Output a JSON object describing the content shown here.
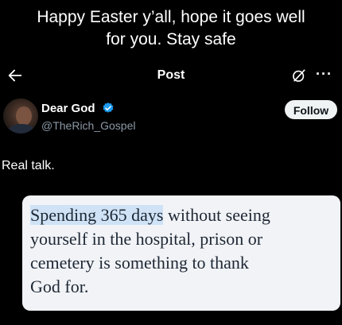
{
  "caption": {
    "line1": "Happy Easter y’all, hope it goes well",
    "line2": "for you. Stay safe"
  },
  "topbar": {
    "title": "Post",
    "more": "···"
  },
  "author": {
    "name": "Dear God",
    "handle": "@TheRich_Gospel",
    "follow_label": "Follow",
    "verified_color": "#1d9bf0"
  },
  "tweet": {
    "text": "Real talk."
  },
  "quote_image": {
    "highlighted": "Spending 365 days",
    "rest_line1": " without seeing",
    "line2": "yourself in the hospital, prison or",
    "line3": "cemetery is something to thank",
    "line4": "God for."
  }
}
